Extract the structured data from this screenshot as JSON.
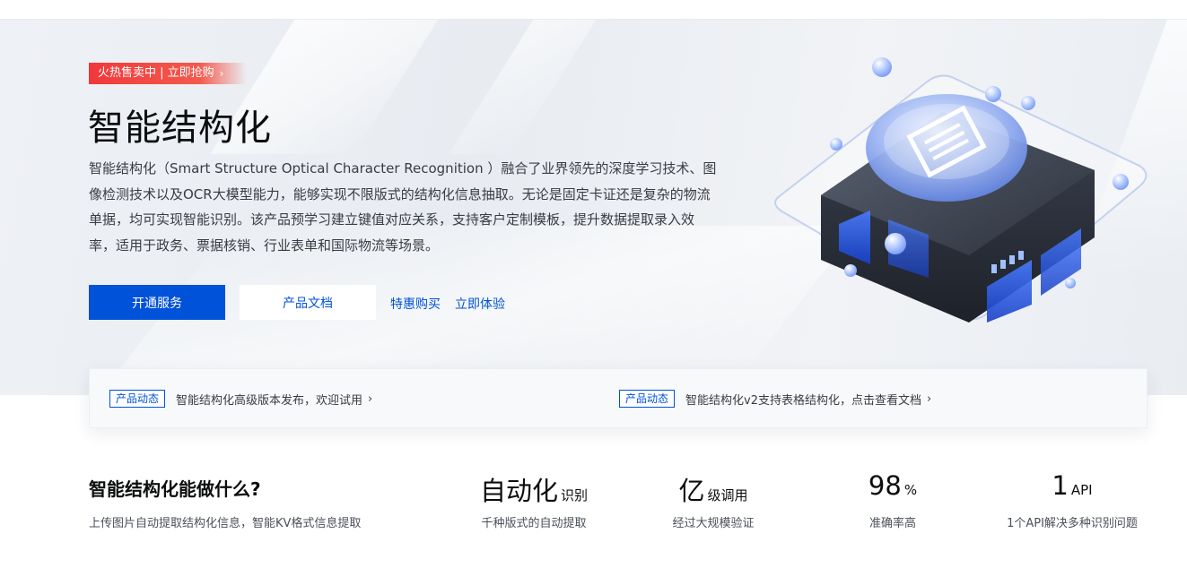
{
  "promo": {
    "label": "火热售卖中 | 立即抢购",
    "chevron": "›"
  },
  "hero": {
    "title": "智能结构化",
    "description": "智能结构化（Smart Structure Optical Character Recognition ）融合了业界领先的深度学习技术、图像检测技术以及OCR大模型能力，能够实现不限版式的结构化信息抽取。无论是固定卡证还是复杂的物流单据，均可实现智能识别。该产品预学习建立键值对应关系，支持客户定制模板，提升数据提取录入效率，适用于政务、票据核销、行业表单和国际物流等场景。",
    "buttons": {
      "primary": "开通服务",
      "secondary": "产品文档"
    },
    "links": {
      "buy": "特惠购买",
      "try": "立即体验"
    }
  },
  "news": [
    {
      "tag": "产品动态",
      "text": "智能结构化高级版本发布，欢迎试用",
      "chevron": "›"
    },
    {
      "tag": "产品动态",
      "text": "智能结构化v2支持表格结构化，点击查看文档",
      "chevron": "›"
    }
  ],
  "features": {
    "heading": "智能结构化能做什么?",
    "subheading": "上传图片自动提取结构化信息，智能KV格式信息提取",
    "stats": [
      {
        "value": "自动化",
        "unit": "识别",
        "desc": "千种版式的自动提取"
      },
      {
        "value": "亿",
        "unit": "级调用",
        "desc": "经过大规模验证"
      },
      {
        "value": "98",
        "unit": "%",
        "desc": "准确率高"
      },
      {
        "value": "1",
        "unit": "API",
        "desc": "1个API解决多种识别问题"
      }
    ]
  },
  "colors": {
    "primary": "#0052d9",
    "promo_red": "#f0383b",
    "text_dark": "#0c0d0e"
  },
  "icons": {
    "illustration": "ocr-chip-illustration-icon"
  }
}
